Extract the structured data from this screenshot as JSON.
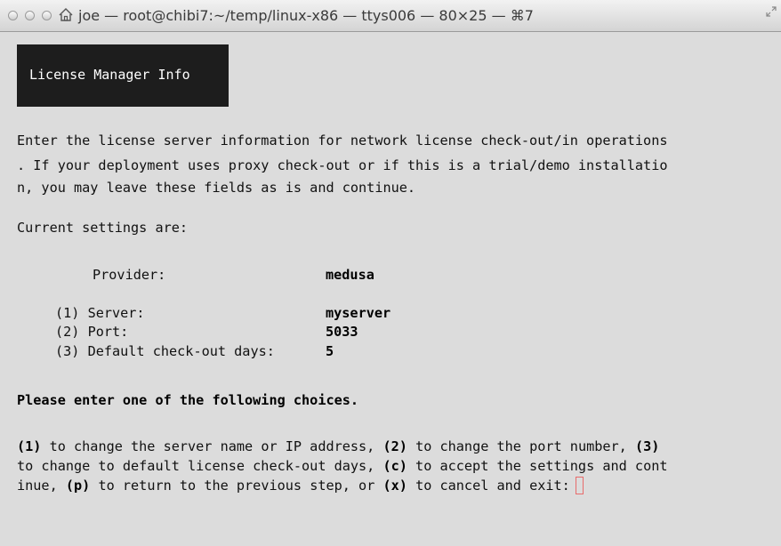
{
  "window": {
    "title": "joe — root@chibi7:~/temp/linux-x86 — ttys006 — 80×25 — ⌘7"
  },
  "terminal": {
    "banner": "License Manager Info",
    "intro": [
      "Enter the license server information for network license check-out/in operations",
      ". If your deployment uses proxy check-out or if this is a trial/demo installatio",
      "n, you may leave these fields as is and continue."
    ],
    "current_settings_label": "Current settings are:",
    "provider": {
      "label": "Provider:",
      "value": "medusa"
    },
    "settings": [
      {
        "label": "(1) Server:",
        "value": "myserver"
      },
      {
        "label": "(2) Port:",
        "value": "5033"
      },
      {
        "label": "(3) Default check-out days:",
        "value": "5"
      }
    ],
    "prompt_heading": "Please enter one of the following choices.",
    "choices": {
      "k1": "(1)",
      "t1": " to change the server name or IP address, ",
      "k2": "(2)",
      "t2": " to change the port number, ",
      "k3": "(3)",
      "t3": "to change to default license check-out days, ",
      "kc": "(c)",
      "tc": " to accept the settings and cont",
      "t4": "inue, ",
      "kp": "(p)",
      "tp": " to return to the previous step, or ",
      "kx": "(x)",
      "tx": " to cancel and exit:"
    }
  }
}
